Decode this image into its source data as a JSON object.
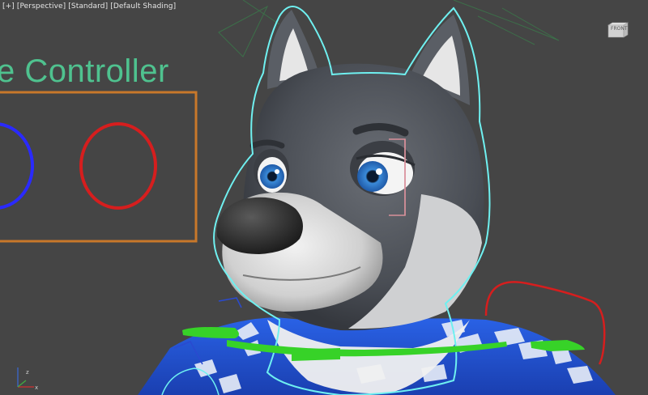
{
  "viewport": {
    "label_plus": "[+]",
    "label_view": "[Perspective]",
    "label_mode": "[Standard]",
    "label_shading": "[Default Shading]"
  },
  "scene": {
    "controller_title": "e Controller"
  },
  "viewcube": {
    "face_label": "FRONT"
  },
  "axis": {
    "x_label": "x",
    "z_label": "z"
  },
  "colors": {
    "background": "#454545",
    "title_green": "#4fc28f",
    "frame_orange": "#c8782a",
    "ring_blue": "#2a2aff",
    "ring_red": "#d61e1e",
    "selection_cyan": "#6ff0f0",
    "controller_green": "#37d228",
    "shirt_blue": "#1e4fd6",
    "fur_dark": "#4a4e55",
    "fur_light": "#d6d6d6",
    "iris_blue": "#2f78c8"
  }
}
